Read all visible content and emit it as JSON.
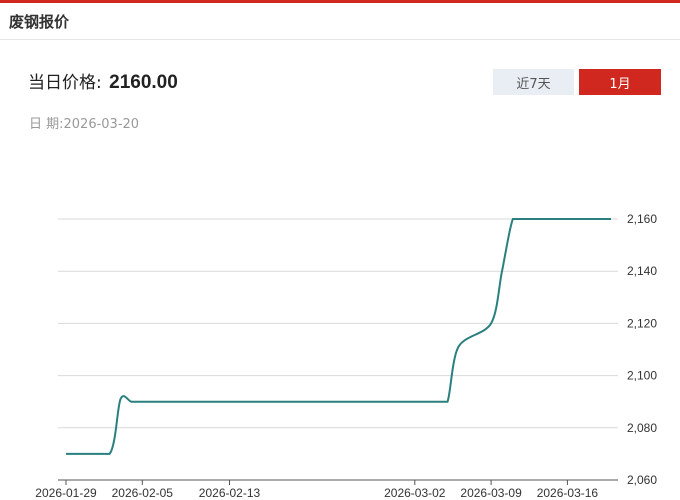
{
  "header": {
    "title": "废钢报价"
  },
  "price": {
    "label": "当日价格:",
    "value": "2160.00"
  },
  "date": {
    "label": "日 期:",
    "value": "2026-03-20"
  },
  "range_buttons": {
    "week": "近7天",
    "month": "1月",
    "active": "month"
  },
  "colors": {
    "accent": "#d0281e",
    "line": "#2a7f7f",
    "grid": "#d9d9d9"
  },
  "chart_data": {
    "type": "line",
    "x_ticks": [
      "2026-01-29",
      "2026-02-05",
      "2026-02-13",
      "2026-03-02",
      "2026-03-09",
      "2026-03-16"
    ],
    "y_ticks": [
      "2,060",
      "2,080",
      "2,100",
      "2,120",
      "2,140",
      "2,160"
    ],
    "ylim": [
      2060,
      2160
    ],
    "grid": true,
    "series": [
      {
        "x": [
          "2026-01-29",
          "2026-01-30",
          "2026-02-02",
          "2026-02-03",
          "2026-02-04",
          "2026-02-05",
          "2026-02-06",
          "2026-02-13",
          "2026-02-27",
          "2026-03-02",
          "2026-03-03",
          "2026-03-04",
          "2026-03-05",
          "2026-03-06",
          "2026-03-09",
          "2026-03-10",
          "2026-03-11",
          "2026-03-12",
          "2026-03-13",
          "2026-03-16",
          "2026-03-17",
          "2026-03-18",
          "2026-03-19",
          "2026-03-20"
        ],
        "values": [
          2070,
          2070,
          2070,
          2091,
          2090,
          2090,
          2090,
          2090,
          2090,
          2090,
          2090,
          2090,
          2090,
          2111,
          2120,
          2140,
          2160,
          2160,
          2160,
          2160,
          2160,
          2160,
          2160,
          2160
        ]
      }
    ]
  }
}
